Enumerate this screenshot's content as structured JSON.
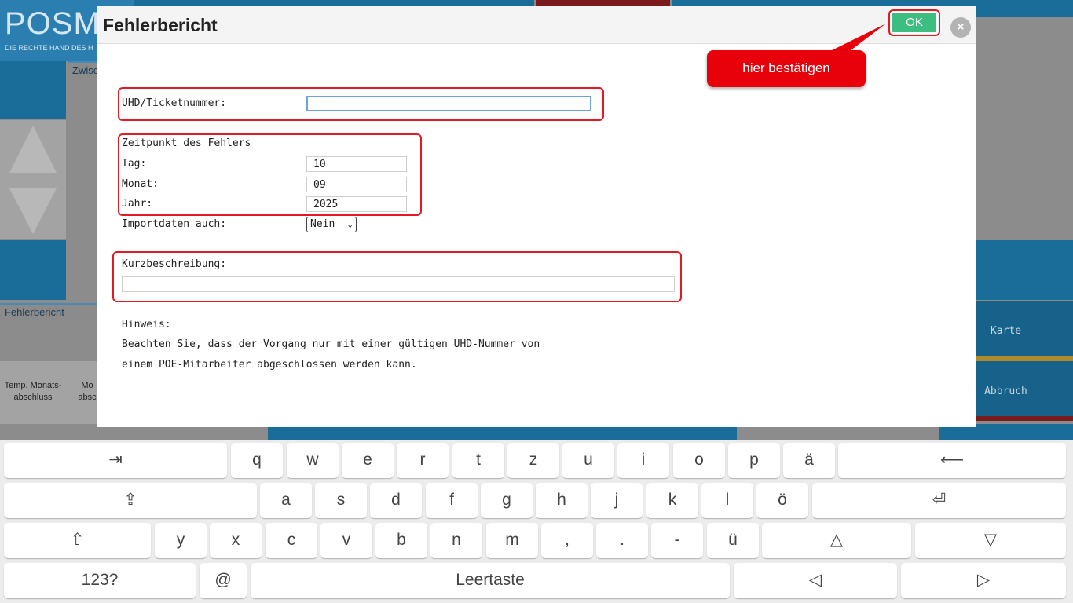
{
  "background": {
    "logo_title": "POSMA",
    "logo_subtitle": "DIE RECHTE HAND DES H",
    "panel_tab_top": "Zwisc",
    "panel_tab_bottom": "Fehlerbericht",
    "btn_temp_monat": "Temp. Monats-\nabschluss",
    "btn_mo": "Mo\nabsc",
    "side_karte": "Karte",
    "side_abbruch": "Abbruch"
  },
  "dialog": {
    "title": "Fehlerbericht",
    "ok_label": "OK",
    "close_label": "×",
    "callout": "hier bestätigen",
    "ticket": {
      "label": "UHD/Ticketnummer:",
      "value": ""
    },
    "zeitpunkt": {
      "heading": "Zeitpunkt des Fehlers",
      "tag_label": "Tag:",
      "tag_value": "10",
      "monat_label": "Monat:",
      "monat_value": "09",
      "jahr_label": "Jahr:",
      "jahr_value": "2025"
    },
    "import": {
      "label": "Importdaten auch:",
      "selected": "Nein"
    },
    "kurz": {
      "label": "Kurzbeschreibung:",
      "value": ""
    },
    "hinweis": {
      "heading": "Hinweis:",
      "line1": "Beachten Sie, dass der Vorgang nur mit einer gültigen UHD-Nummer von",
      "line2": "einem POE-Mitarbeiter abgeschlossen werden kann."
    }
  },
  "keyboard": {
    "row1": [
      "⇥",
      "q",
      "w",
      "e",
      "r",
      "t",
      "z",
      "u",
      "i",
      "o",
      "p",
      "ä",
      "⟵"
    ],
    "row2": [
      "⇪",
      "a",
      "s",
      "d",
      "f",
      "g",
      "h",
      "j",
      "k",
      "l",
      "ö",
      "⏎"
    ],
    "row3": [
      "⇧",
      "y",
      "x",
      "c",
      "v",
      "b",
      "n",
      "m",
      ",",
      ".",
      "-",
      "ü",
      "△",
      "▽"
    ],
    "row4": [
      "123?",
      "@",
      "Leertaste",
      "◁",
      "▷"
    ]
  },
  "colors": {
    "accent_blue": "#1a6d99",
    "ok_green": "#3dbd7f",
    "highlight_red": "#e01b24",
    "callout_red": "#e8000b"
  }
}
